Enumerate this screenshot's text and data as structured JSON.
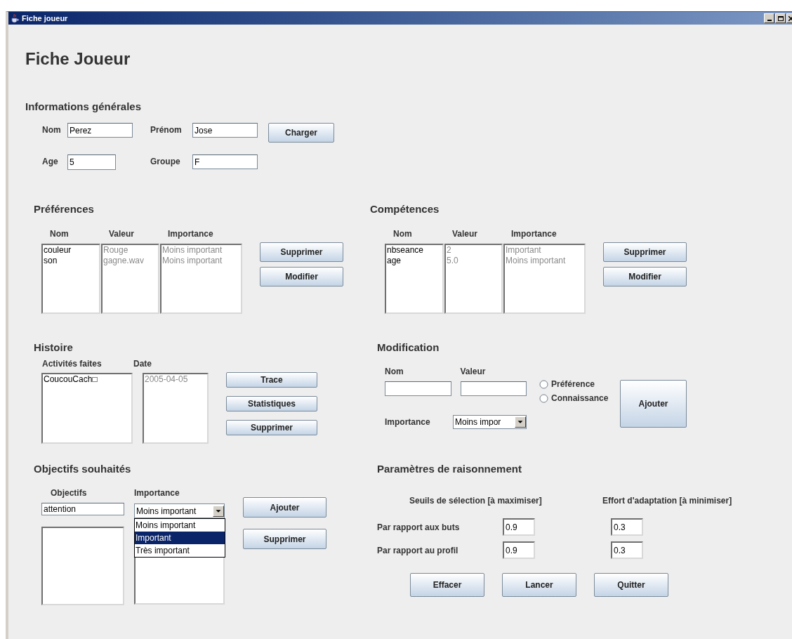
{
  "window": {
    "title": "Fiche joueur"
  },
  "heading": "Fiche Joueur",
  "general": {
    "title": "Informations générales",
    "fields": [
      {
        "label": "Nom",
        "value": "Perez"
      },
      {
        "label": "Prénom",
        "value": "Jose"
      },
      {
        "label": "Age",
        "value": "5"
      },
      {
        "label": "Groupe",
        "value": "F"
      }
    ],
    "button": "Charger"
  },
  "preferences": {
    "title": "Préférences",
    "columns": [
      {
        "label": "Nom",
        "disabled": false
      },
      {
        "label": "Valeur",
        "disabled": true
      },
      {
        "label": "Importance",
        "disabled": true
      }
    ],
    "rows": [
      [
        "couleur",
        "Rouge",
        "Moins important"
      ],
      [
        "son",
        "gagne.wav",
        "Moins important"
      ]
    ],
    "buttons": [
      "Supprimer",
      "Modifier"
    ]
  },
  "competences": {
    "title": "Compétences",
    "columns": [
      {
        "label": "Nom",
        "disabled": false
      },
      {
        "label": "Valeur",
        "disabled": true
      },
      {
        "label": "Importance",
        "disabled": true
      }
    ],
    "rows": [
      [
        "nbseance",
        "2",
        "Important"
      ],
      [
        "age",
        "5.0",
        "Moins important"
      ]
    ],
    "buttons": [
      "Supprimer",
      "Modifier"
    ]
  },
  "histoire": {
    "title": "Histoire",
    "columns": [
      {
        "label": "Activités faites",
        "disabled": false
      },
      {
        "label": "Date",
        "disabled": true
      }
    ],
    "rows": [
      [
        "CoucouCach□",
        "2005-04-05"
      ]
    ],
    "buttons": [
      "Trace",
      "Statistiques",
      "Supprimer"
    ]
  },
  "modification": {
    "title": "Modification",
    "fields": [
      {
        "label": "Nom"
      },
      {
        "label": "Valeur"
      }
    ],
    "importance": {
      "label": "Importance",
      "value": "Moins impor"
    },
    "radios": [
      {
        "label": "Préférence",
        "selected": false
      },
      {
        "label": "Connaissance",
        "selected": false
      }
    ],
    "button": "Ajouter"
  },
  "objectifs": {
    "title": "Objectifs souhaités",
    "columns": [
      "Objectifs",
      "Importance"
    ],
    "objective": "attention",
    "combo": "Moins important",
    "options": [
      {
        "label": "Moins important",
        "selected": false
      },
      {
        "label": "Important",
        "selected": true
      },
      {
        "label": "Très important",
        "selected": false
      }
    ],
    "buttons": [
      "Ajouter",
      "Supprimer"
    ]
  },
  "parametres": {
    "title": "Paramètres de raisonnement",
    "headers": [
      "Seuils de sélection [à maximiser]",
      "Effort d'adaptation [à minimiser]"
    ],
    "rows": [
      {
        "label": "Par rapport aux buts",
        "values": [
          "0.9",
          "0.3"
        ]
      },
      {
        "label": "Par rapport au profil",
        "values": [
          "0.9",
          "0.3"
        ]
      }
    ],
    "buttons": [
      "Effacer",
      "Lancer",
      "Quitter"
    ]
  }
}
